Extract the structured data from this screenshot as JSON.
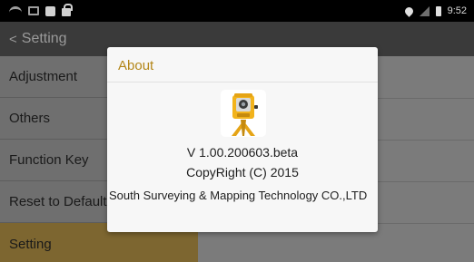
{
  "status_bar": {
    "time": "9:52",
    "icons": [
      "wifi-icon",
      "image-icon",
      "square-icon",
      "lock-icon",
      "location-icon",
      "signal-icon",
      "battery-icon"
    ]
  },
  "header": {
    "back_glyph": "<",
    "title": "Setting"
  },
  "menu": {
    "items": [
      {
        "label": "Adjustment"
      },
      {
        "label": "Others"
      },
      {
        "label": "Function Key"
      },
      {
        "label": "Reset to Default"
      },
      {
        "label": "Setting"
      }
    ],
    "active_index": 4
  },
  "dialog": {
    "title": "About",
    "logo": "total-station-icon",
    "version": "V 1.00.200603.beta",
    "copyright": "CopyRight (C) 2015",
    "company": "South Surveying & Mapping Technology CO.,LTD"
  },
  "colors": {
    "accent": "#b38618",
    "active_item": "#7d6630",
    "status_bar": "#000000",
    "header": "#3a3a3a"
  }
}
